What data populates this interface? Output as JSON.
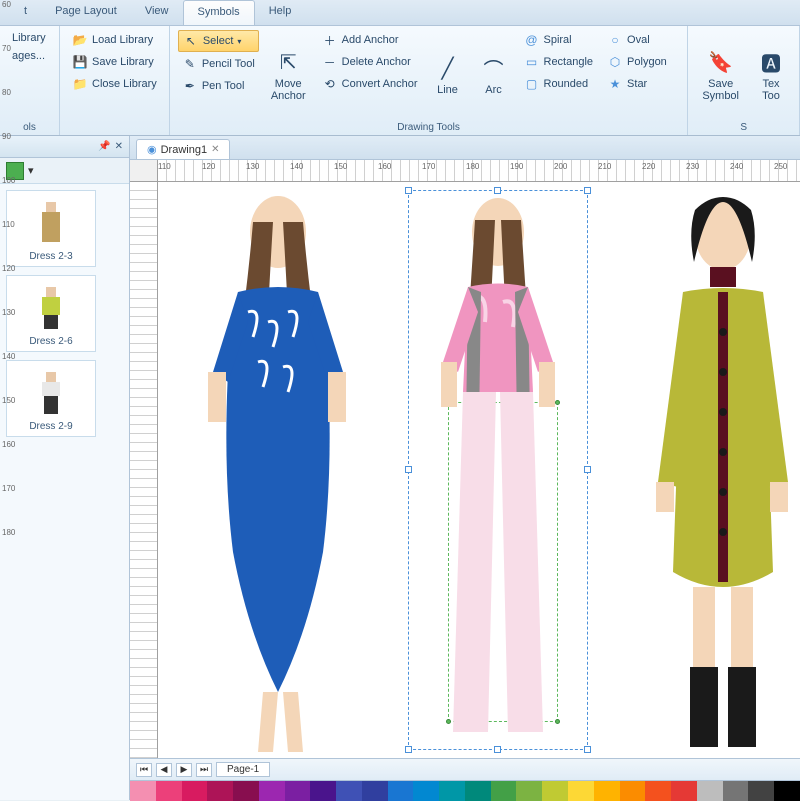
{
  "tabs": {
    "t0": "t",
    "t1": "Page Layout",
    "t2": "View",
    "t3": "Symbols",
    "t4": "Help"
  },
  "ribbon": {
    "library": {
      "title": "ols",
      "side_btn1": "Library",
      "side_btn2": "ages...",
      "load": "Load Library",
      "save": "Save Library",
      "close": "Close Library"
    },
    "tools": {
      "select": "Select",
      "pencil": "Pencil Tool",
      "pen": "Pen Tool",
      "move_anchor": "Move\nAnchor",
      "add_anchor": "Add Anchor",
      "delete_anchor": "Delete Anchor",
      "convert_anchor": "Convert Anchor",
      "line": "Line",
      "arc": "Arc",
      "spiral": "Spiral",
      "rectangle": "Rectangle",
      "rounded": "Rounded",
      "oval": "Oval",
      "polygon": "Polygon",
      "star": "Star",
      "title": "Drawing Tools"
    },
    "save_symbol": "Save\nSymbol",
    "text_tool": "Tex\nToo",
    "right_title": "S"
  },
  "sidepanel": {
    "pin": "✕",
    "drop": "▾",
    "items": [
      {
        "label": "Dress 2-3"
      },
      {
        "label": "Dress 2-6"
      },
      {
        "label": "Dress 2-9"
      }
    ]
  },
  "doc": {
    "title": "Drawing1"
  },
  "page": {
    "label": "Page-1"
  },
  "ruler_h": [
    "110",
    "120",
    "130",
    "140",
    "150",
    "160",
    "170",
    "180",
    "190",
    "200",
    "210",
    "220",
    "230",
    "240",
    "250"
  ],
  "ruler_v": [
    "60",
    "70",
    "80",
    "90",
    "100",
    "110",
    "120",
    "130",
    "140",
    "150",
    "160",
    "170",
    "180"
  ],
  "palette": [
    "#f48fb1",
    "#ec407a",
    "#d81b60",
    "#ad1457",
    "#880e4f",
    "#9c27b0",
    "#7b1fa2",
    "#4a148c",
    "#3f51b5",
    "#303f9f",
    "#1976d2",
    "#0288d1",
    "#0097a7",
    "#00897b",
    "#43a047",
    "#7cb342",
    "#c0ca33",
    "#fdd835",
    "#ffb300",
    "#fb8c00",
    "#f4511e",
    "#e53935",
    "#bdbdbd",
    "#757575",
    "#424242",
    "#000000"
  ]
}
